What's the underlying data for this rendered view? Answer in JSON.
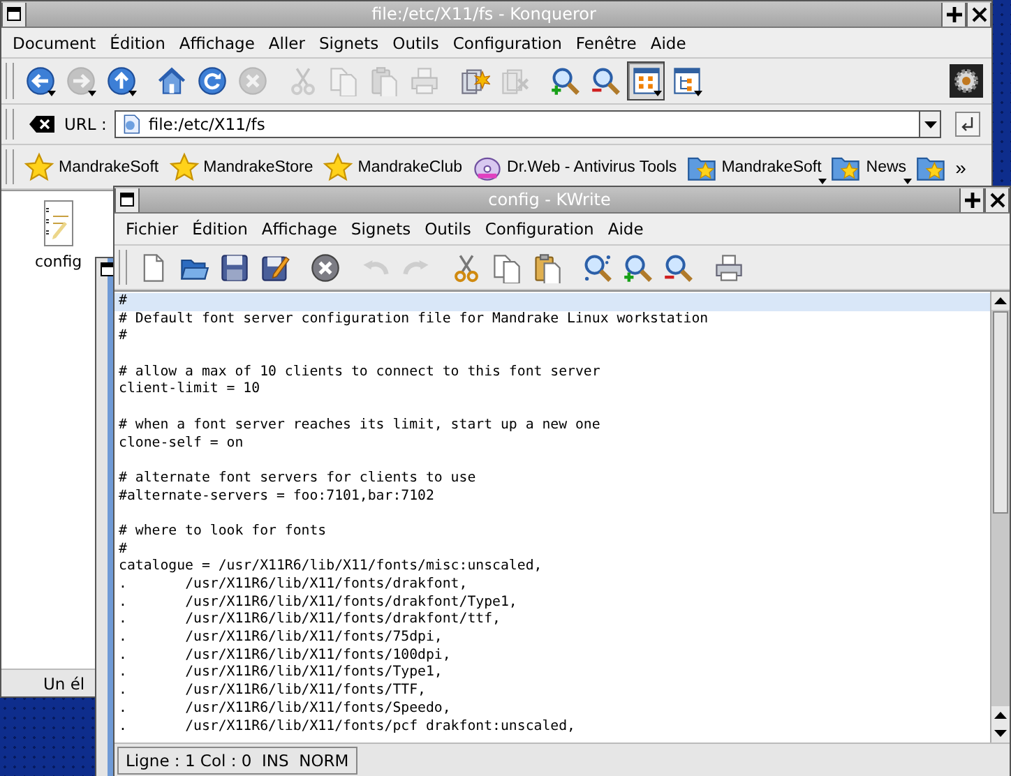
{
  "konqueror": {
    "title": "file:/etc/X11/fs - Konqueror",
    "menu": [
      "Document",
      "Édition",
      "Affichage",
      "Aller",
      "Signets",
      "Outils",
      "Configuration",
      "Fenêtre",
      "Aide"
    ],
    "toolbar": [
      {
        "kind": "back",
        "disabled": false,
        "dropdown": true,
        "selected": false
      },
      {
        "kind": "forward",
        "disabled": true,
        "dropdown": true,
        "selected": false
      },
      {
        "kind": "up",
        "disabled": false,
        "dropdown": true,
        "selected": false
      },
      {
        "kind": "home",
        "disabled": false,
        "dropdown": false,
        "selected": false
      },
      {
        "kind": "reload",
        "disabled": false,
        "dropdown": false,
        "selected": false
      },
      {
        "kind": "stop",
        "disabled": true,
        "dropdown": false,
        "selected": false
      },
      {
        "kind": "cut",
        "disabled": true,
        "dropdown": false,
        "selected": false
      },
      {
        "kind": "copy",
        "disabled": true,
        "dropdown": false,
        "selected": false
      },
      {
        "kind": "paste",
        "disabled": true,
        "dropdown": false,
        "selected": false
      },
      {
        "kind": "print",
        "disabled": true,
        "dropdown": false,
        "selected": false
      },
      {
        "kind": "copyto",
        "disabled": false,
        "dropdown": false,
        "selected": false
      },
      {
        "kind": "moveto",
        "disabled": true,
        "dropdown": false,
        "selected": false
      },
      {
        "kind": "zoomin",
        "disabled": false,
        "dropdown": false,
        "selected": false
      },
      {
        "kind": "zoomout",
        "disabled": false,
        "dropdown": false,
        "selected": false
      },
      {
        "kind": "viewicons",
        "disabled": false,
        "dropdown": true,
        "selected": true
      },
      {
        "kind": "viewtree",
        "disabled": false,
        "dropdown": true,
        "selected": false
      }
    ],
    "url_label": "URL :",
    "url": "file:/etc/X11/fs",
    "bookmarks": [
      {
        "kind": "star",
        "label": "MandrakeSoft",
        "dropdown": false
      },
      {
        "kind": "star",
        "label": "MandrakeStore",
        "dropdown": false
      },
      {
        "kind": "star",
        "label": "MandrakeClub",
        "dropdown": false
      },
      {
        "kind": "app",
        "label": "Dr.Web - Antivirus Tools",
        "dropdown": false
      },
      {
        "kind": "folder",
        "label": "MandrakeSoft",
        "dropdown": true
      },
      {
        "kind": "folder",
        "label": "News",
        "dropdown": true
      },
      {
        "kind": "folder"
      }
    ],
    "more": "»",
    "file_icon": {
      "label": "config"
    },
    "status": "Un él"
  },
  "kwrite": {
    "title": "config - KWrite",
    "menu": [
      "Fichier",
      "Édition",
      "Affichage",
      "Signets",
      "Outils",
      "Configuration",
      "Aide"
    ],
    "toolbar": [
      {
        "kind": "new",
        "disabled": false
      },
      {
        "kind": "open",
        "disabled": false
      },
      {
        "kind": "save",
        "disabled": false
      },
      {
        "kind": "saveas",
        "disabled": false
      },
      {
        "kind": "close",
        "disabled": false
      },
      {
        "kind": "undo",
        "disabled": true
      },
      {
        "kind": "redo",
        "disabled": true
      },
      {
        "kind": "cut",
        "disabled": false
      },
      {
        "kind": "copy",
        "disabled": false
      },
      {
        "kind": "paste",
        "disabled": false
      },
      {
        "kind": "find",
        "disabled": false
      },
      {
        "kind": "zoomin",
        "disabled": false
      },
      {
        "kind": "zoomout",
        "disabled": false
      },
      {
        "kind": "print",
        "disabled": false
      }
    ],
    "lines": [
      {
        "text": "#",
        "current": true
      },
      {
        "text": "# Default font server configuration file for Mandrake Linux workstation",
        "current": false
      },
      {
        "text": "#",
        "current": false
      },
      {
        "current": false
      },
      {
        "text": "# allow a max of 10 clients to connect to this font server",
        "current": false
      },
      {
        "text": "client-limit = 10",
        "current": false
      },
      {
        "current": false
      },
      {
        "text": "# when a font server reaches its limit, start up a new one",
        "current": false
      },
      {
        "text": "clone-self = on",
        "current": false
      },
      {
        "current": false
      },
      {
        "text": "# alternate font servers for clients to use",
        "current": false
      },
      {
        "text": "#alternate-servers = foo:7101,bar:7102",
        "current": false
      },
      {
        "current": false
      },
      {
        "text": "# where to look for fonts",
        "current": false
      },
      {
        "text": "#",
        "current": false
      },
      {
        "text": "catalogue = /usr/X11R6/lib/X11/fonts/misc:unscaled,",
        "current": false
      },
      {
        "text": ".\t/usr/X11R6/lib/X11/fonts/drakfont,",
        "current": false
      },
      {
        "text": ".\t/usr/X11R6/lib/X11/fonts/drakfont/Type1,",
        "current": false
      },
      {
        "text": ".\t/usr/X11R6/lib/X11/fonts/drakfont/ttf,",
        "current": false
      },
      {
        "text": ".\t/usr/X11R6/lib/X11/fonts/75dpi,",
        "current": false
      },
      {
        "text": ".\t/usr/X11R6/lib/X11/fonts/100dpi,",
        "current": false
      },
      {
        "text": ".\t/usr/X11R6/lib/X11/fonts/Type1,",
        "current": false
      },
      {
        "text": ".\t/usr/X11R6/lib/X11/fonts/TTF,",
        "current": false
      },
      {
        "text": ".\t/usr/X11R6/lib/X11/fonts/Speedo,",
        "current": false
      },
      {
        "text": ".\t/usr/X11R6/lib/X11/fonts/pcf drakfont:unscaled,",
        "current": false
      }
    ],
    "status": "Ligne : 1 Col : 0  INS  NORM"
  }
}
